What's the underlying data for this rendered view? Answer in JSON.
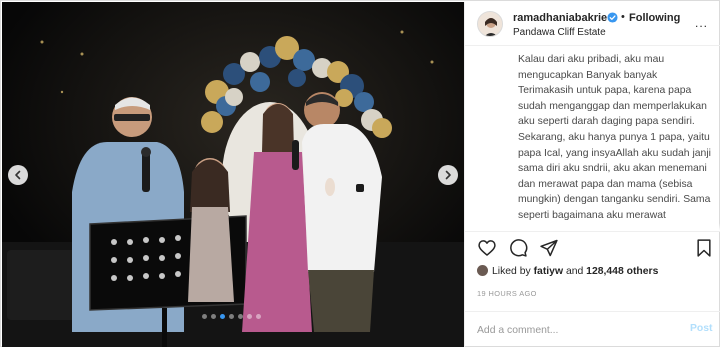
{
  "header": {
    "username": "ramadhaniabakrie",
    "separator": "•",
    "follow_status": "Following",
    "location": "Pandawa Cliff Estate",
    "more_label": "..."
  },
  "caption": {
    "text": "Kalau dari aku pribadi, aku mau mengucapkan Banyak banyak Terimakasih untuk papa, karena papa sudah menganggap dan memperlakukan aku seperti darah daging papa sendiri. Sekarang, aku hanya punya 1 papa, yaitu papa Ical, yang insyaAllah aku sudah janji sama diri aku sndrii, aku akan menemani dan merawat papa dan mama (sebisa mungkin) dengan tanganku sendiri. Sama seperti bagaimana aku merawat"
  },
  "likes": {
    "prefix": "Liked by",
    "user": "fatiyw",
    "middle": "and",
    "count": "128,448 others"
  },
  "timestamp": "19 HOURS AGO",
  "comment": {
    "placeholder": "Add a comment...",
    "post_label": "Post"
  },
  "carousel": {
    "slide_count": 7,
    "active_index": 2
  },
  "icons": [
    "chevron-left-icon",
    "chevron-right-icon",
    "verified-badge-icon",
    "more-options-icon",
    "heart-icon",
    "comment-icon",
    "share-icon",
    "bookmark-icon"
  ],
  "colors": {
    "link_blue": "#3897f0",
    "post_disabled": "#b2dffc",
    "verified_blue": "#3897f0",
    "text_dark": "#262626",
    "text_muted": "#999999"
  }
}
